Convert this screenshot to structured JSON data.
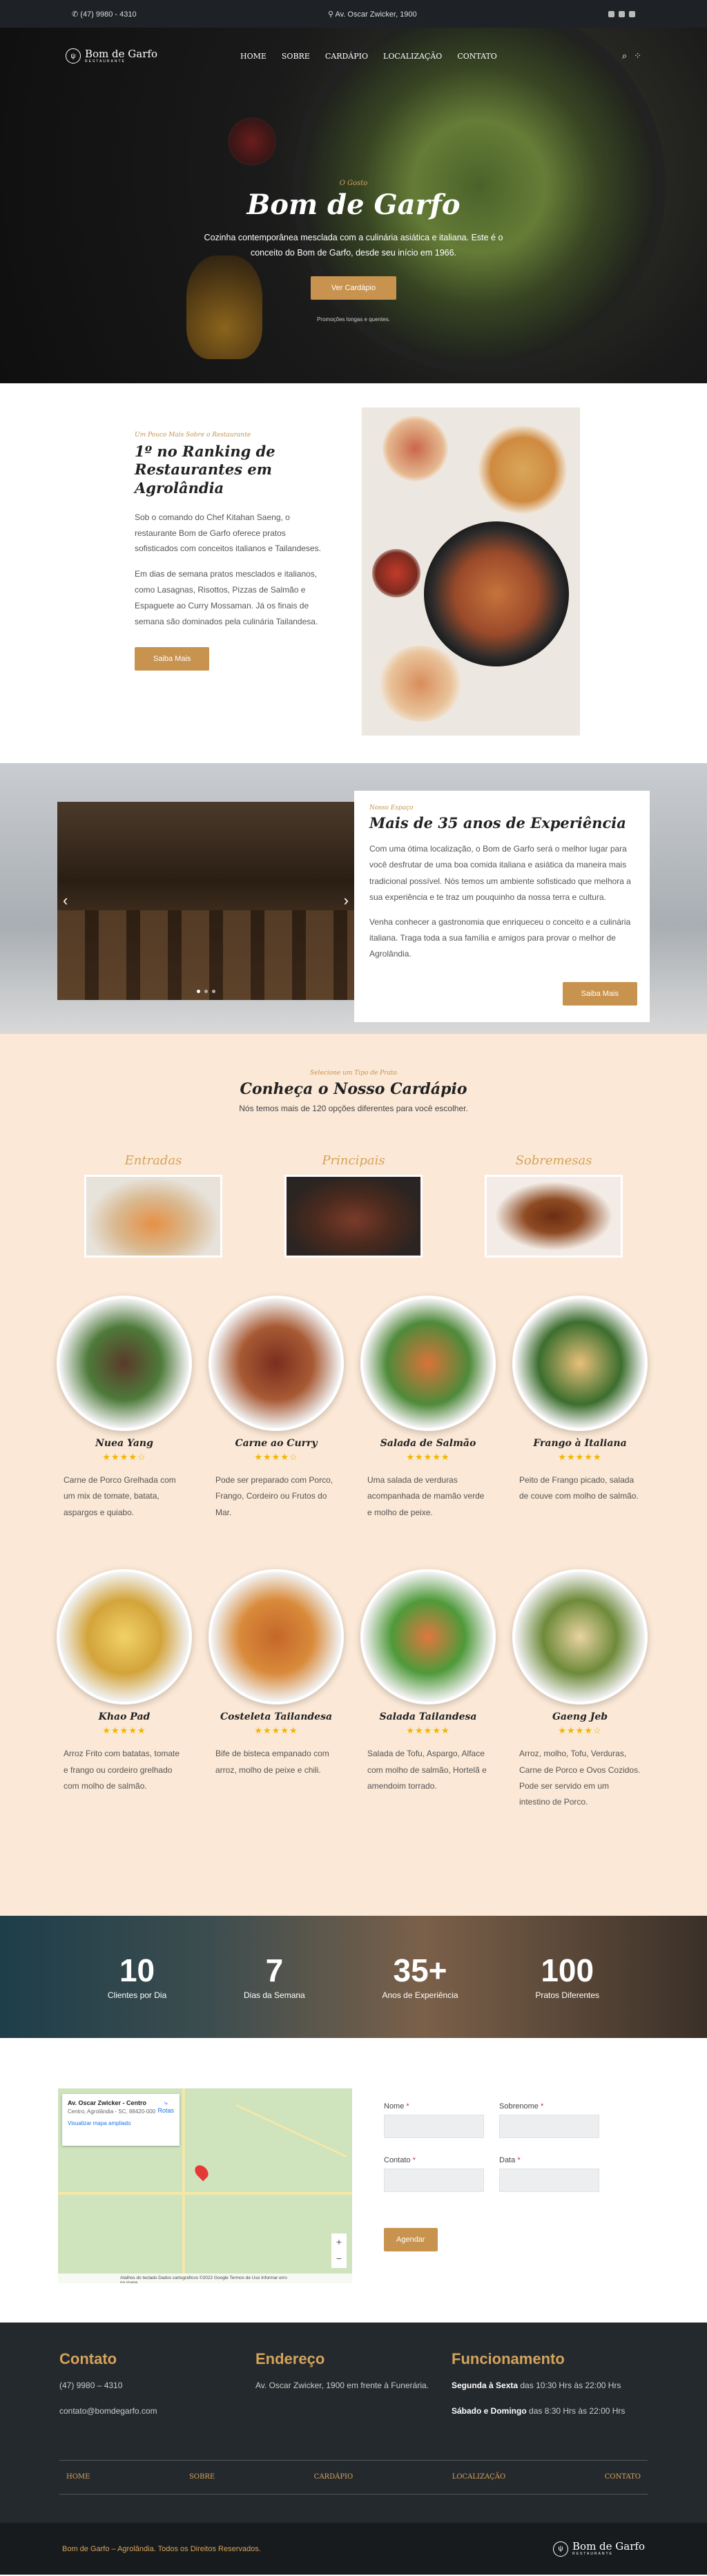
{
  "topbar": {
    "phone_icon": "phone-icon",
    "phone": "(47) 9980 - 4310",
    "pin_icon": "map-pin-icon",
    "address": "Av. Oscar Zwicker, 1900",
    "social": [
      "facebook-icon",
      "instagram-icon",
      "whatsapp-icon"
    ]
  },
  "logo": {
    "name": "Bom de Garfo",
    "sub": "RESTAURANTE"
  },
  "nav": {
    "items": [
      "HOME",
      "SOBRE",
      "CARDÁPIO",
      "LOCALIZAÇÃO",
      "CONTATO"
    ]
  },
  "hero": {
    "kicker": "O Gosto",
    "title": "Bom de Garfo",
    "text": "Cozinha contemporânea mesclada com a culinária asiática e italiana. Este é o conceito do Bom de Garfo, desde seu início em 1966.",
    "button": "Ver Cardápio",
    "note": "Promoções longas e quentes."
  },
  "about": {
    "kicker": "Um Pouco Mais Sobre o Restaurante",
    "title": "1º no Ranking de Restaurantes em Agrolândia",
    "p1": "Sob o comando do Chef Kitahan Saeng, o restaurante Bom de Garfo oferece pratos sofisticados com conceitos italianos e Tailandeses.",
    "p2": "Em dias de semana pratos mesclados e italianos, como Lasagnas, Risottos, Pizzas de Salmão e Espaguete ao Curry Mossaman. Já os finais de semana são dominados pela culinária Tailandesa.",
    "button": "Saiba Mais"
  },
  "experience": {
    "kicker": "Nosso Espaço",
    "title": "Mais de 35 anos de Experiência",
    "p1": "Com uma ótima localização, o Bom de Garfo será o melhor lugar para você desfrutar de uma boa comida italiana e asiática da maneira mais tradicional possível. Nós temos um ambiente sofisticado que melhora a sua experiência e te traz um pouquinho da nossa terra e cultura.",
    "p2": "Venha conhecer a gastronomia que enriqueceu o conceito e a culinária italiana. Traga toda a sua família e amigos para provar o melhor de Agrolândia.",
    "button": "Saiba Mais"
  },
  "cardapio": {
    "kicker": "Selecione um Tipo de Prato",
    "title": "Conheça o Nosso Cardápio",
    "lead": "Nós temos mais de 120 opções diferentes para você escolher.",
    "categories": [
      "Entradas",
      "Principais",
      "Sobremesas"
    ],
    "dishes": [
      {
        "name": "Nuea Yang",
        "stars": "★★★★☆",
        "desc": "Carne de Porco Grelhada com um mix de tomate, batata, aspargos e quiabo."
      },
      {
        "name": "Carne ao Curry",
        "stars": "★★★★☆",
        "desc": "Pode ser preparado com Porco, Frango, Cordeiro ou Frutos do Mar."
      },
      {
        "name": "Salada de Salmão",
        "stars": "★★★★★",
        "desc": "Uma salada de verduras acompanhada de mamão verde e molho de peixe."
      },
      {
        "name": "Frango à Italiana",
        "stars": "★★★★★",
        "desc": "Peito de Frango picado, salada de couve com molho de salmão."
      },
      {
        "name": "Khao Pad",
        "stars": "★★★★★",
        "desc": "Arroz Frito com batatas, tomate e frango ou cordeiro grelhado com molho de salmão."
      },
      {
        "name": "Costeleta Tailandesa",
        "stars": "★★★★★",
        "desc": "Bife de bisteca empanado com arroz, molho de peixe e chili."
      },
      {
        "name": "Salada Tailandesa",
        "stars": "★★★★★",
        "desc": "Salada de Tofu, Aspargo, Alface com molho de salmão, Hortelã e amendoim torrado."
      },
      {
        "name": "Gaeng Jeb",
        "stars": "★★★★☆",
        "desc": "Arroz, molho, Tofu, Verduras, Carne de Porco e Ovos Cozidos. Pode ser servido em um intestino de Porco."
      }
    ]
  },
  "stats": [
    {
      "num": "10",
      "label": "Clientes por Dia"
    },
    {
      "num": "7",
      "label": "Dias da Semana"
    },
    {
      "num": "35+",
      "label": "Anos de Experiência"
    },
    {
      "num": "100",
      "label": "Pratos Diferentes"
    }
  ],
  "map": {
    "title": "Av. Oscar Zwicker - Centro",
    "address": "Centro, Agrolândia - SC, 88420-000",
    "link": "Visualizar mapa ampliado",
    "route": "Rotas",
    "footer": "Atalhos do teclado   Dados cartográficos ©2022 Google   Termos de Uso   Informar erro no mapa"
  },
  "form": {
    "name": "Nome",
    "surname": "Sobrenome",
    "contact": "Contato",
    "date": "Data",
    "required": "*",
    "button": "Agendar"
  },
  "footer": {
    "contato": {
      "title": "Contato",
      "phone": "(47) 9980 – 4310",
      "email": "contato@bomdegarfo.com"
    },
    "endereco": {
      "title": "Endereço",
      "text": "Av. Oscar Zwicker, 1900 em frente à Funerária."
    },
    "funcionamento": {
      "title": "Funcionamento",
      "l1_bold": "Segunda à Sexta",
      "l1": " das 10:30 Hrs às 22:00 Hrs",
      "l2_bold": "Sábado e Domingo",
      "l2": " das 8:30 Hrs às 22:00 Hrs"
    },
    "nav": [
      "HOME",
      "SOBRE",
      "CARDÁPIO",
      "LOCALIZAÇÃO",
      "CONTATO"
    ],
    "copyright": "Bom de Garfo – Agrolândia. Todos os Direitos Reservados."
  },
  "colors": {
    "accent": "#c8934e",
    "dark": "#24292d",
    "cream": "#fbe8d6",
    "star": "#f2b600"
  }
}
